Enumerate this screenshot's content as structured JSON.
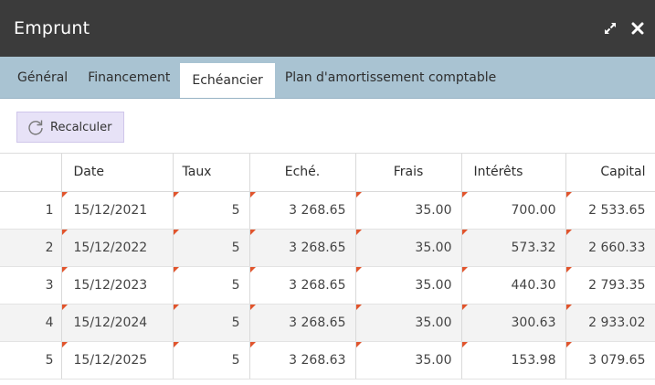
{
  "window": {
    "title": "Emprunt",
    "icons": {
      "expand": "expand-icon",
      "close": "close-icon"
    }
  },
  "tabs": [
    {
      "label": "Général",
      "active": false
    },
    {
      "label": "Financement",
      "active": false
    },
    {
      "label": "Echéancier",
      "active": true
    },
    {
      "label": "Plan d'amortissement comptable",
      "active": false
    }
  ],
  "toolbar": {
    "recalculate_label": "Recalculer",
    "recalculate_icon": "refresh-icon"
  },
  "table": {
    "columns": [
      "",
      "Date",
      "Taux",
      "Eché.",
      "Frais",
      "Intérêts",
      "Capital"
    ],
    "rows": [
      [
        "1",
        "15/12/2021",
        "5",
        "3 268.65",
        "35.00",
        "700.00",
        "2 533.65"
      ],
      [
        "2",
        "15/12/2022",
        "5",
        "3 268.65",
        "35.00",
        "573.32",
        "2 660.33"
      ],
      [
        "3",
        "15/12/2023",
        "5",
        "3 268.65",
        "35.00",
        "440.30",
        "2 793.35"
      ],
      [
        "4",
        "15/12/2024",
        "5",
        "3 268.65",
        "35.00",
        "300.63",
        "2 933.02"
      ],
      [
        "5",
        "15/12/2025",
        "5",
        "3 268.63",
        "35.00",
        "153.98",
        "3 079.65"
      ]
    ]
  },
  "colors": {
    "titlebar": "#3b3b3b",
    "tabbar": "#a9c3d2",
    "button_bg": "#e7e2f7",
    "cell_flag": "#e1542c"
  }
}
